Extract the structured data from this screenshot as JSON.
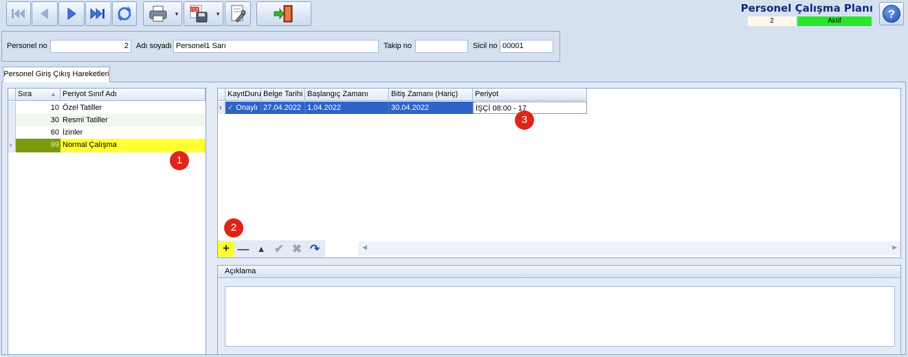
{
  "toolbar": {
    "buttons": [
      "first-record",
      "previous-record",
      "next-record",
      "last-record",
      "refresh",
      "print",
      "export-pdf",
      "report-design",
      "exit"
    ]
  },
  "header": {
    "title": "Personel Çalışma Planı",
    "record_count": "2",
    "status": "Aktif",
    "status_color": "#27e62b"
  },
  "form": {
    "personel_no_label": "Personel no",
    "personel_no_value": "2",
    "adi_soyadi_label": "Adı soyadı",
    "adi_soyadi_value": "Personel1 Sarı",
    "takip_no_label": "Takip no",
    "takip_no_value": "",
    "sicil_no_label": "Sicil no",
    "sicil_no_value": "00001"
  },
  "tabs": [
    {
      "label": "Personel Giriş Çıkış Hareketleri",
      "active": true
    }
  ],
  "left_grid": {
    "columns": [
      "Sıra",
      "Periyot Sınıf Adı"
    ],
    "rows": [
      {
        "sira": "10",
        "ad": "Özel Tatiller"
      },
      {
        "sira": "30",
        "ad": "Resmi Tatiller"
      },
      {
        "sira": "60",
        "ad": "İzinler"
      },
      {
        "sira": "99",
        "ad": "Normal Çalışma",
        "selected": true
      }
    ],
    "highlight_color": "#ffff33"
  },
  "right_grid": {
    "columns": [
      "KayıtDuru",
      "Belge Tarihi",
      "Başlangıç Zamanı",
      "Bitiş Zamanı (Hariç)",
      "Periyot"
    ],
    "rows": [
      {
        "kayit_durumu": "Onaylı",
        "belge_tarihi": "27.04.2022",
        "baslangic": "1.04.2022",
        "bitis": "30.04.2022",
        "periyot": "İŞÇİ 08:00 - 17"
      }
    ],
    "selection_color": "#2f63c8"
  },
  "navigator": {
    "buttons": [
      "add",
      "remove",
      "move-up",
      "confirm",
      "cancel",
      "refresh"
    ]
  },
  "aciklama": {
    "label": "Açıklama",
    "value": ""
  },
  "markers": [
    "1",
    "2",
    "3"
  ]
}
